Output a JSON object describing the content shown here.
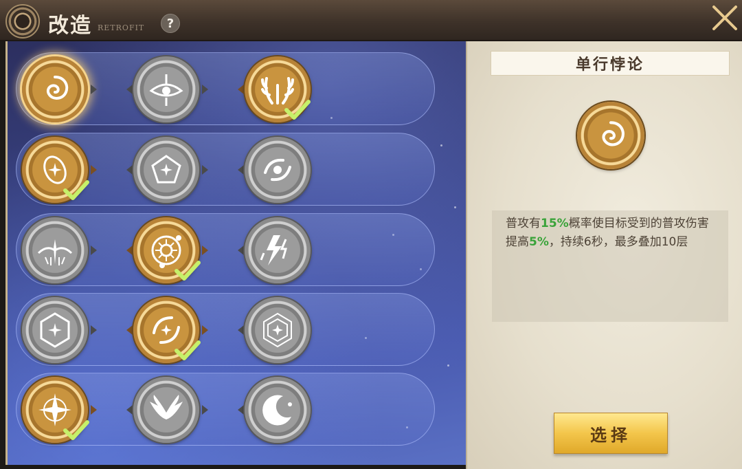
{
  "header": {
    "title": "改造",
    "subtitle": "RETROFIT",
    "help_label": "?"
  },
  "rows": [
    {
      "nodes": [
        {
          "icon": "swirl-icon",
          "state": "selected",
          "checked": false
        },
        {
          "icon": "eye-icon",
          "state": "locked",
          "checked": false
        },
        {
          "icon": "antlers-icon",
          "state": "active",
          "checked": true
        }
      ]
    },
    {
      "nodes": [
        {
          "icon": "orbit-spark-icon",
          "state": "active",
          "checked": true
        },
        {
          "icon": "pentagon-spark-icon",
          "state": "locked",
          "checked": false
        },
        {
          "icon": "vortex-icon",
          "state": "locked",
          "checked": false
        }
      ]
    },
    {
      "nodes": [
        {
          "icon": "winged-spark-icon",
          "state": "locked",
          "checked": false
        },
        {
          "icon": "sun-gear-icon",
          "state": "active",
          "checked": true
        },
        {
          "icon": "lightning-icon",
          "state": "locked",
          "checked": false
        }
      ]
    },
    {
      "nodes": [
        {
          "icon": "hexagon-spark-icon",
          "state": "locked",
          "checked": false
        },
        {
          "icon": "swirl-spark-icon",
          "state": "active",
          "checked": true
        },
        {
          "icon": "hex-frame-spark-icon",
          "state": "locked",
          "checked": false
        }
      ]
    },
    {
      "nodes": [
        {
          "icon": "starburst-icon",
          "state": "active",
          "checked": true
        },
        {
          "icon": "wings-icon",
          "state": "locked",
          "checked": false
        },
        {
          "icon": "crescent-moon-icon",
          "state": "locked",
          "checked": false
        }
      ]
    }
  ],
  "detail": {
    "skill_name": "单行悖论",
    "icon": "swirl-icon",
    "desc_part1": "普攻有",
    "desc_val1": "15%",
    "desc_part2": "概率使目标受到的普攻伤害提高",
    "desc_val2": "5%",
    "desc_part3": "，持续6秒，最多叠加10层",
    "select_label": "选择"
  },
  "colors": {
    "gold": "#c9943f",
    "gray": "#9c9c9c",
    "highlight_green": "#3aa33a",
    "check_green": "#c6f06a",
    "panel_blue": "#4a5bb0",
    "button_gold": "#f3c64b"
  }
}
